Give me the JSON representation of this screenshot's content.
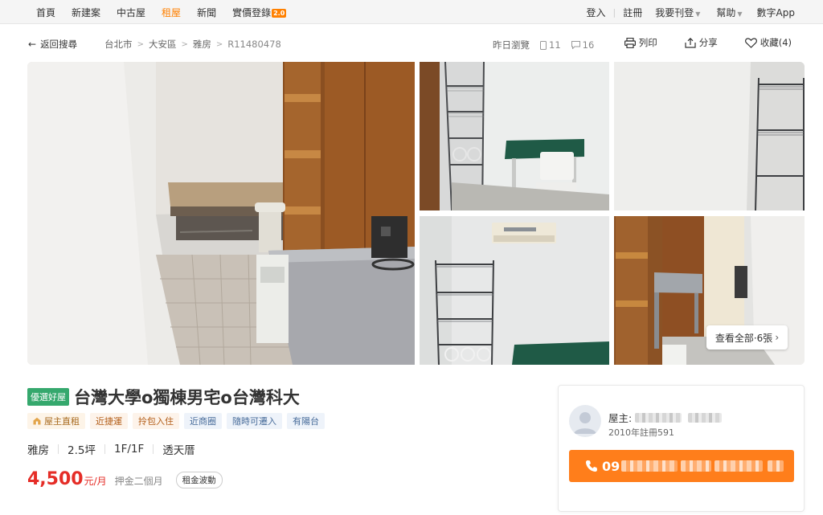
{
  "nav": {
    "left": [
      "首頁",
      "新建案",
      "中古屋",
      "租屋",
      "新聞",
      "實價登錄"
    ],
    "active_index": 3,
    "badge": "2.0",
    "right": {
      "login": "登入",
      "register": "註冊",
      "post": "我要刊登",
      "help": "幫助",
      "app": "數字App"
    }
  },
  "breadcrumb": {
    "back": "返回搜尋",
    "items": [
      "台北市",
      "大安區",
      "雅房",
      "R11480478"
    ]
  },
  "stats": {
    "viewed": "昨日瀏覽",
    "views": "11",
    "comments": "16"
  },
  "actions": {
    "print": "列印",
    "share": "分享",
    "favorite": "收藏(4)"
  },
  "gallery": {
    "see_all": "查看全部·6張",
    "photos": [
      "main-room-photo",
      "shelf-desk-photo",
      "wall-shelf-photo",
      "aircon-shelf-photo",
      "desk-corridor-photo"
    ]
  },
  "listing": {
    "premium_tag": "優選好屋",
    "title": "台灣大學o獨棟男宅o台灣科大",
    "tags": [
      "屋主直租",
      "近捷運",
      "拎包入住",
      "近商圈",
      "隨時可遷入",
      "有陽台"
    ],
    "specs": [
      "雅房",
      "2.5坪",
      "1F/1F",
      "透天厝"
    ],
    "price": "4,500",
    "price_unit": "元/月",
    "deposit": "押金二個月",
    "fluctuation": "租金波動"
  },
  "contact": {
    "owner_label": "屋主:",
    "registered": "2010年註冊591",
    "phone_prefix": "09"
  },
  "colors": {
    "accent": "#ff8000",
    "price": "#e52d27",
    "premium": "#35a86d",
    "phone_button": "#ff7e1b"
  }
}
